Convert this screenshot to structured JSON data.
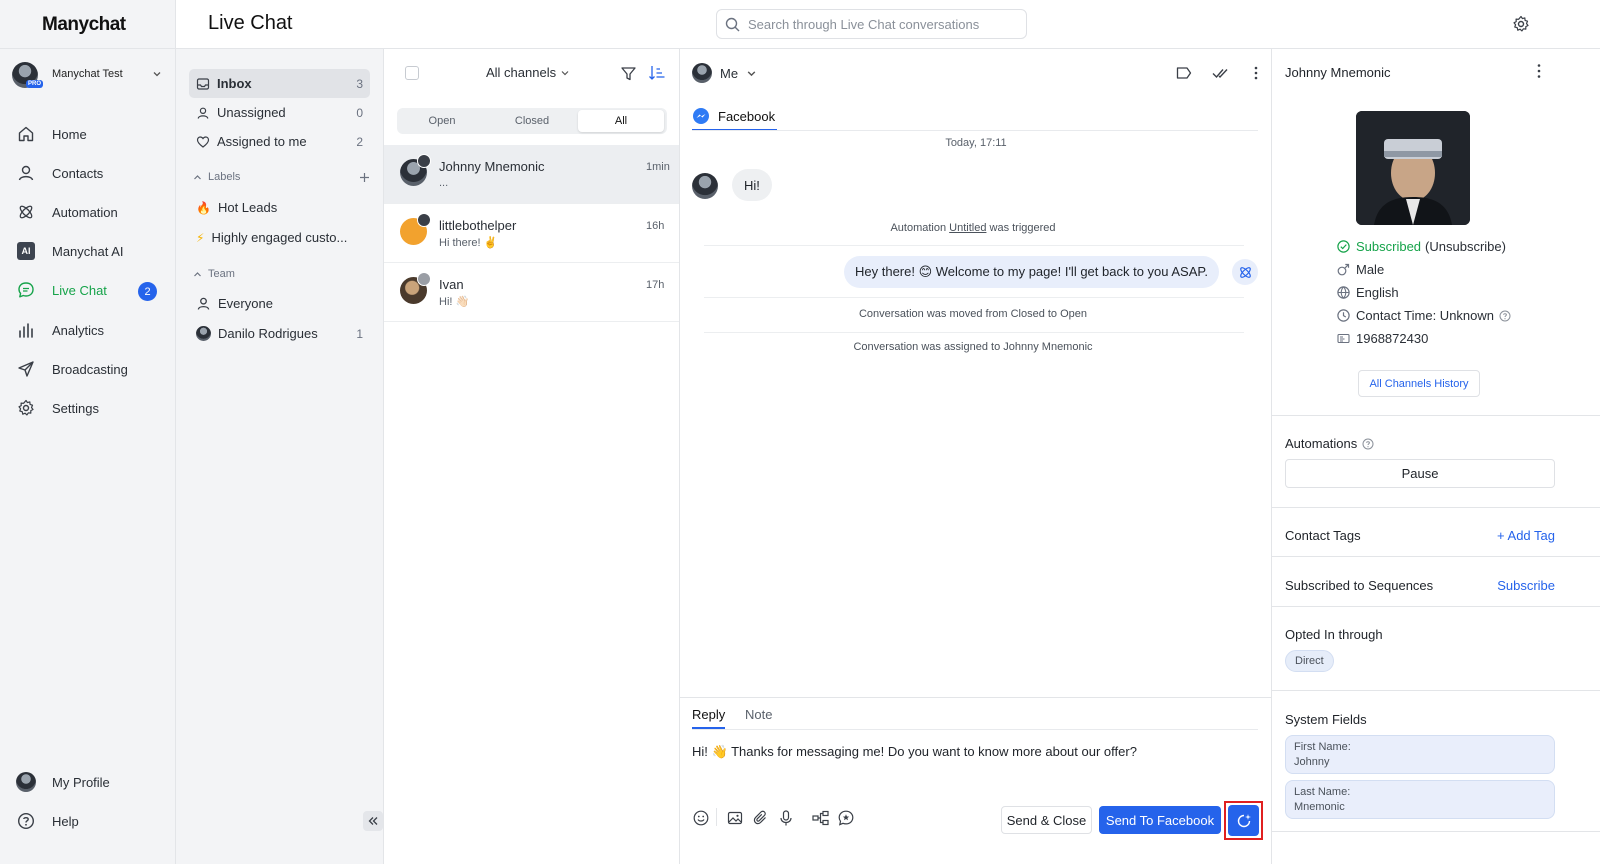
{
  "app": {
    "logo": "Manychat",
    "page_title": "Live Chat"
  },
  "search": {
    "placeholder": "Search through Live Chat conversations"
  },
  "account": {
    "name": "Manychat Test",
    "badge": "PRO"
  },
  "nav": {
    "items": [
      {
        "label": "Home",
        "icon": "home-icon"
      },
      {
        "label": "Contacts",
        "icon": "person-icon"
      },
      {
        "label": "Automation",
        "icon": "automation-icon"
      },
      {
        "label": "Manychat AI",
        "icon": "ai-icon",
        "icon_text": "AI"
      },
      {
        "label": "Live Chat",
        "icon": "chat-icon",
        "badge": "2"
      },
      {
        "label": "Analytics",
        "icon": "bar-chart-icon"
      },
      {
        "label": "Broadcasting",
        "icon": "send-icon"
      },
      {
        "label": "Settings",
        "icon": "gear-icon"
      }
    ],
    "bottom": [
      {
        "label": "My Profile",
        "icon": "avatar"
      },
      {
        "label": "Help",
        "icon": "help-icon"
      }
    ],
    "active_color": "#16a34a"
  },
  "folders": {
    "inbox": {
      "label": "Inbox",
      "count": "3"
    },
    "unassigned": {
      "label": "Unassigned",
      "count": "0"
    },
    "assigned": {
      "label": "Assigned to me",
      "count": "2"
    },
    "labels_header": "Labels",
    "labels": [
      {
        "label": "Hot Leads",
        "emoji": "🔥"
      },
      {
        "label": "Highly engaged custo...",
        "emoji": "⚡"
      }
    ],
    "team_header": "Team",
    "team": [
      {
        "label": "Everyone",
        "count": ""
      },
      {
        "label": "Danilo Rodrigues",
        "count": "1"
      }
    ]
  },
  "conv_list": {
    "channel_filter": "All channels",
    "tabs": [
      "Open",
      "Closed",
      "All"
    ],
    "active_tab": "All",
    "items": [
      {
        "name": "Johnny Mnemonic",
        "preview": "...",
        "time": "1min"
      },
      {
        "name": "littlebothelper",
        "preview": "Hi there! ✌️",
        "time": "16h"
      },
      {
        "name": "Ivan",
        "preview": "Hi! 👋🏻",
        "time": "17h"
      }
    ]
  },
  "chat": {
    "assignee": "Me",
    "channel_tab": "Facebook",
    "date": "Today, 17:11",
    "incoming": "Hi!",
    "system1_pre": "Automation ",
    "system1_link": "Untitled",
    "system1_post": " was triggered",
    "outgoing": "Hey there! 😊 Welcome to my page! I'll get back to you ASAP.",
    "system2": "Conversation was moved from Closed to Open",
    "system3": "Conversation was assigned to Johnny Mnemonic",
    "composer_tabs": [
      "Reply",
      "Note"
    ],
    "reply_text": "Hi! 👋 Thanks for messaging me! Do you want to know more about our offer?",
    "send_close": "Send & Close",
    "send_facebook": "Send To Facebook",
    "accent": "#2563eb"
  },
  "contact": {
    "name": "Johnny Mnemonic",
    "subscribed": "Subscribed",
    "unsubscribe": "(Unsubscribe)",
    "gender": "Male",
    "language": "English",
    "contact_time": "Contact Time: Unknown",
    "id": "1968872430",
    "history_button": "All Channels History",
    "automations_title": "Automations",
    "pause_button": "Pause",
    "tags_title": "Contact Tags",
    "add_tag": "+ Add Tag",
    "sequences_title": "Subscribed to Sequences",
    "subscribe": "Subscribe",
    "opted_title": "Opted In through",
    "opted_value": "Direct",
    "system_fields_title": "System Fields",
    "fields": [
      {
        "key": "First Name:",
        "value": "Johnny"
      },
      {
        "key": "Last Name:",
        "value": "Mnemonic"
      }
    ]
  }
}
